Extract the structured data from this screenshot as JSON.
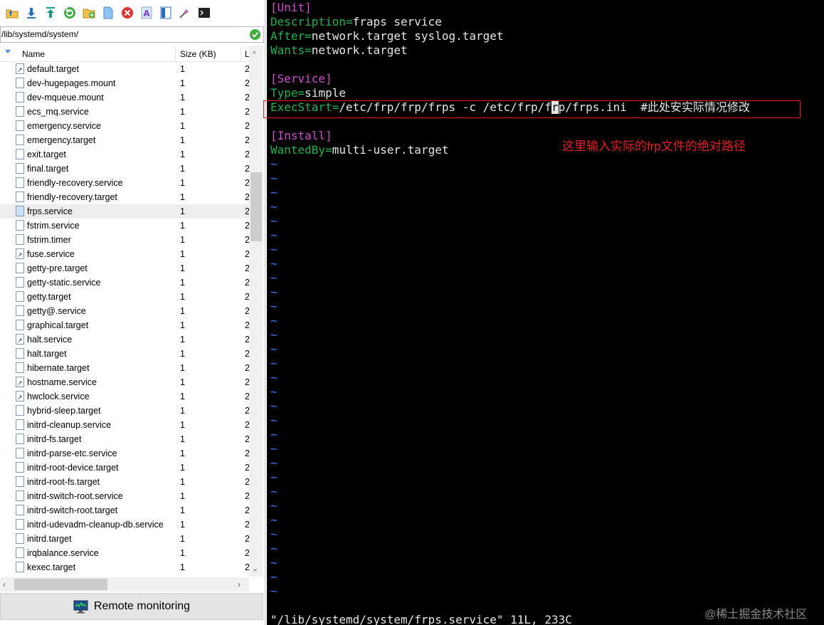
{
  "toolbar": {
    "icons": [
      "folder-up-icon",
      "download-icon",
      "upload-icon",
      "refresh-icon",
      "new-folder-icon",
      "new-file-icon",
      "delete-icon",
      "rename-icon",
      "properties-icon",
      "tools-icon",
      "terminal-icon"
    ]
  },
  "path": {
    "value": "/lib/systemd/system/"
  },
  "columns": {
    "name": "Name",
    "size": "Size (KB)",
    "extra": "L"
  },
  "files": [
    {
      "name": "default.target",
      "size": "1",
      "extra": "2",
      "link": true
    },
    {
      "name": "dev-hugepages.mount",
      "size": "1",
      "extra": "2",
      "link": false
    },
    {
      "name": "dev-mqueue.mount",
      "size": "1",
      "extra": "2",
      "link": false
    },
    {
      "name": "ecs_mq.service",
      "size": "1",
      "extra": "2",
      "link": false
    },
    {
      "name": "emergency.service",
      "size": "1",
      "extra": "2",
      "link": false
    },
    {
      "name": "emergency.target",
      "size": "1",
      "extra": "2",
      "link": false
    },
    {
      "name": "exit.target",
      "size": "1",
      "extra": "2",
      "link": false
    },
    {
      "name": "final.target",
      "size": "1",
      "extra": "2",
      "link": false
    },
    {
      "name": "friendly-recovery.service",
      "size": "1",
      "extra": "2",
      "link": false
    },
    {
      "name": "friendly-recovery.target",
      "size": "1",
      "extra": "2",
      "link": false
    },
    {
      "name": "frps.service",
      "size": "1",
      "extra": "2",
      "link": false,
      "selected": true
    },
    {
      "name": "fstrim.service",
      "size": "1",
      "extra": "2",
      "link": false
    },
    {
      "name": "fstrim.timer",
      "size": "1",
      "extra": "2",
      "link": false
    },
    {
      "name": "fuse.service",
      "size": "1",
      "extra": "2",
      "link": true
    },
    {
      "name": "getty-pre.target",
      "size": "1",
      "extra": "2",
      "link": false
    },
    {
      "name": "getty-static.service",
      "size": "1",
      "extra": "2",
      "link": false
    },
    {
      "name": "getty.target",
      "size": "1",
      "extra": "2",
      "link": false
    },
    {
      "name": "getty@.service",
      "size": "1",
      "extra": "2",
      "link": false
    },
    {
      "name": "graphical.target",
      "size": "1",
      "extra": "2",
      "link": false
    },
    {
      "name": "halt.service",
      "size": "1",
      "extra": "2",
      "link": true
    },
    {
      "name": "halt.target",
      "size": "1",
      "extra": "2",
      "link": false
    },
    {
      "name": "hibernate.target",
      "size": "1",
      "extra": "2",
      "link": false
    },
    {
      "name": "hostname.service",
      "size": "1",
      "extra": "2",
      "link": true
    },
    {
      "name": "hwclock.service",
      "size": "1",
      "extra": "2",
      "link": true
    },
    {
      "name": "hybrid-sleep.target",
      "size": "1",
      "extra": "2",
      "link": false
    },
    {
      "name": "initrd-cleanup.service",
      "size": "1",
      "extra": "2",
      "link": false
    },
    {
      "name": "initrd-fs.target",
      "size": "1",
      "extra": "2",
      "link": false
    },
    {
      "name": "initrd-parse-etc.service",
      "size": "1",
      "extra": "2",
      "link": false
    },
    {
      "name": "initrd-root-device.target",
      "size": "1",
      "extra": "2",
      "link": false
    },
    {
      "name": "initrd-root-fs.target",
      "size": "1",
      "extra": "2",
      "link": false
    },
    {
      "name": "initrd-switch-root.service",
      "size": "1",
      "extra": "2",
      "link": false
    },
    {
      "name": "initrd-switch-root.target",
      "size": "1",
      "extra": "2",
      "link": false
    },
    {
      "name": "initrd-udevadm-cleanup-db.service",
      "size": "1",
      "extra": "2",
      "link": false
    },
    {
      "name": "initrd.target",
      "size": "1",
      "extra": "2",
      "link": false
    },
    {
      "name": "irqbalance.service",
      "size": "1",
      "extra": "2",
      "link": false
    },
    {
      "name": "kexec.target",
      "size": "1",
      "extra": "2",
      "link": false
    }
  ],
  "remote": {
    "label": "Remote monitoring"
  },
  "editor": {
    "lines": [
      [
        {
          "t": "[Unit]",
          "c": "mag"
        }
      ],
      [
        {
          "t": "Description=",
          "c": "grn"
        },
        {
          "t": "fraps service",
          "c": "wht"
        }
      ],
      [
        {
          "t": "After=",
          "c": "grn"
        },
        {
          "t": "network.target syslog.target",
          "c": "wht"
        }
      ],
      [
        {
          "t": "Wants=",
          "c": "grn"
        },
        {
          "t": "network.target",
          "c": "wht"
        }
      ],
      [],
      [
        {
          "t": "[Service]",
          "c": "mag"
        }
      ],
      [
        {
          "t": "Type=",
          "c": "grn"
        },
        {
          "t": "simple",
          "c": "wht"
        }
      ],
      [
        {
          "t": "ExecStart=",
          "c": "grn"
        },
        {
          "t": "/etc/frp/frp/frps -c /etc/frp/f",
          "c": "wht"
        },
        {
          "t": "r",
          "c": "cursor"
        },
        {
          "t": "p/frps.ini  #此处安实际情况修改",
          "c": "wht"
        }
      ],
      [],
      [
        {
          "t": "[Install]",
          "c": "mag"
        }
      ],
      [
        {
          "t": "WantedBy=",
          "c": "grn"
        },
        {
          "t": "multi-user.target",
          "c": "wht"
        }
      ]
    ],
    "tilde": "~",
    "tilde_count": 31,
    "annotation": "这里输入实际的frp文件的绝对路径",
    "status": "\"/lib/systemd/system/frps.service\" 11L, 233C",
    "watermark": "@稀土掘金技术社区"
  },
  "colors": {
    "magenta": "#d24dd2",
    "green": "#21b34a",
    "tilde": "#3b78ff",
    "highlight": "#e02020"
  }
}
